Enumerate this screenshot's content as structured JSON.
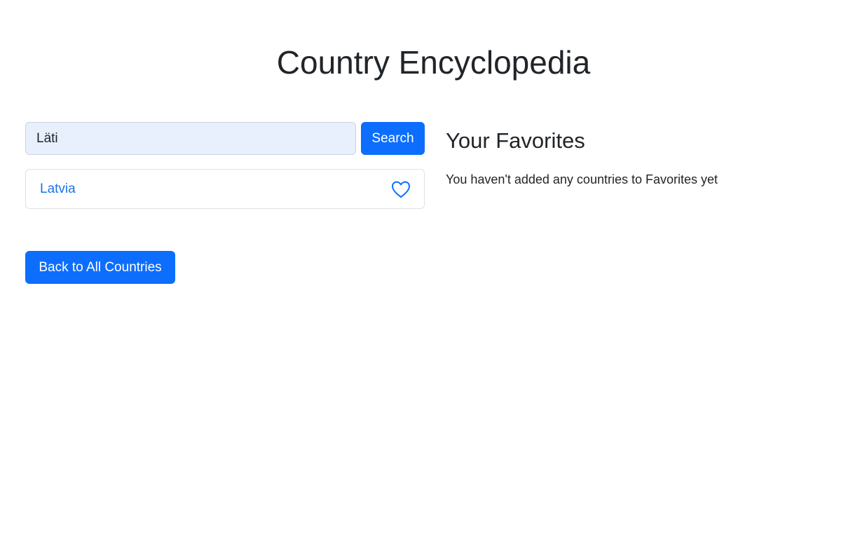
{
  "header": {
    "title": "Country Encyclopedia"
  },
  "search": {
    "value": "Läti",
    "button_label": "Search"
  },
  "results": [
    {
      "name": "Latvia",
      "favorite_icon": "heart-outline-icon",
      "is_favorite": false
    }
  ],
  "favorites": {
    "title": "Your Favorites",
    "empty_message": "You haven't added any countries to Favorites yet"
  },
  "navigation": {
    "back_label": "Back to All Countries"
  },
  "colors": {
    "primary": "#0d6efd",
    "link": "#1a73e8",
    "text": "#212529",
    "input_background": "#e8f0fe",
    "border": "#dee2e6"
  }
}
